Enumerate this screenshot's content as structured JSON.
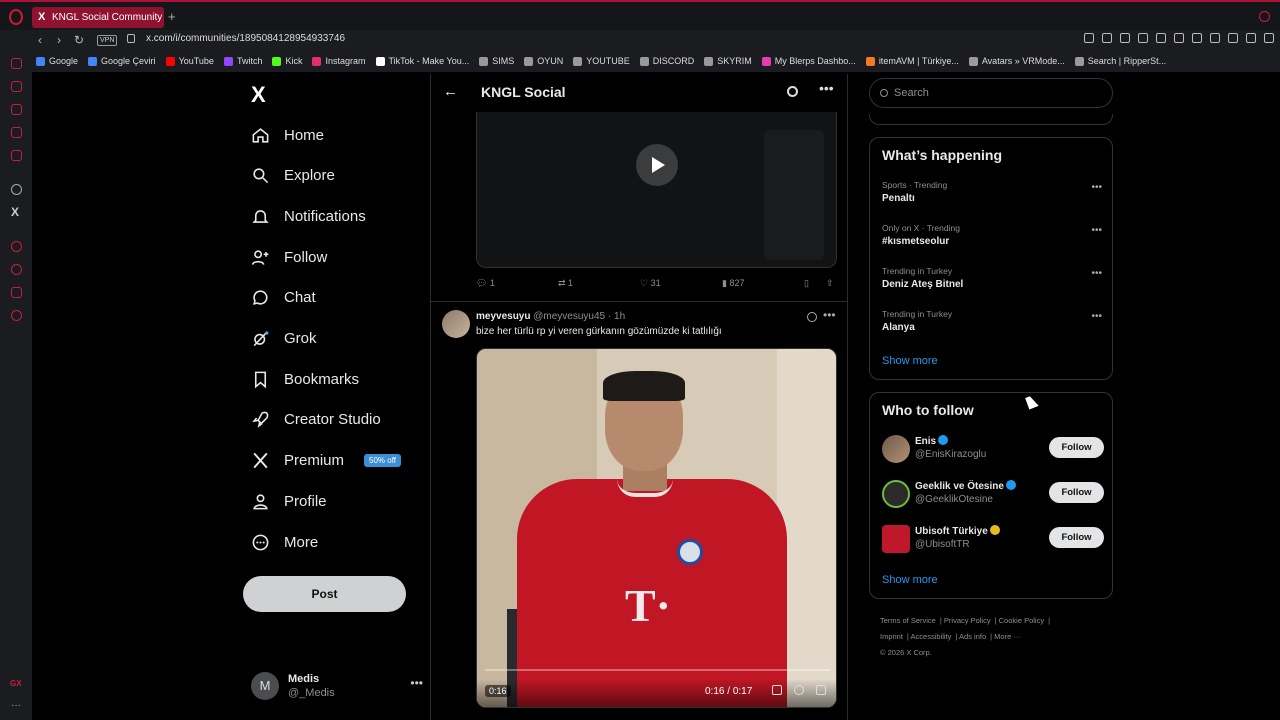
{
  "browser": {
    "tab_title": "KNGL Social Community /",
    "url": "x.com/i/communities/1895084128954933746",
    "vpn_label": "VPN",
    "bookmarks": [
      {
        "label": "Google",
        "color": "#4285f4"
      },
      {
        "label": "Google Çeviri",
        "color": "#4285f4"
      },
      {
        "label": "YouTube",
        "color": "#ff0000"
      },
      {
        "label": "Twitch",
        "color": "#9146ff"
      },
      {
        "label": "Kick",
        "color": "#53fc18"
      },
      {
        "label": "Instagram",
        "color": "#e1306c"
      },
      {
        "label": "TikTok - Make You...",
        "color": "#ffffff"
      },
      {
        "label": "SIMS",
        "color": "#999999"
      },
      {
        "label": "OYUN",
        "color": "#999999"
      },
      {
        "label": "YOUTUBE",
        "color": "#999999"
      },
      {
        "label": "DISCORD",
        "color": "#999999"
      },
      {
        "label": "SKYRIM",
        "color": "#999999"
      },
      {
        "label": "My Blerps Dashbo...",
        "color": "#e63cb1"
      },
      {
        "label": "itemAVM | Türkiye...",
        "color": "#f47a20"
      },
      {
        "label": "Avatars » VRMode...",
        "color": "#9a9a9a"
      },
      {
        "label": "Search | RipperSt...",
        "color": "#9a9a9a"
      }
    ]
  },
  "nav": {
    "brand": "X",
    "items": [
      {
        "label": "Home"
      },
      {
        "label": "Explore"
      },
      {
        "label": "Notifications"
      },
      {
        "label": "Follow"
      },
      {
        "label": "Chat"
      },
      {
        "label": "Grok"
      },
      {
        "label": "Bookmarks"
      },
      {
        "label": "Creator Studio"
      },
      {
        "label": "Premium",
        "badge": "50% off"
      },
      {
        "label": "Profile"
      },
      {
        "label": "More"
      }
    ],
    "post_label": "Post",
    "account": {
      "initial": "M",
      "name": "Medis",
      "handle": "@_Medis"
    }
  },
  "main": {
    "title": "KNGL Social",
    "post1_actions": {
      "replies": "1",
      "reposts": "1",
      "likes": "31",
      "views": "827"
    },
    "post2": {
      "name": "meyvesuyu",
      "handle": "@meyvesuyu45",
      "time": "· 1h",
      "text": "bize her türlü rp yi veren gürkanın gözümüzde ki tatlılığı",
      "elapsed": "0:16",
      "duration": "0:17"
    }
  },
  "right": {
    "search_placeholder": "Search",
    "whats_happening": "What’s happening",
    "trends": [
      {
        "context": "Sports · Trending",
        "title": "Penaltı"
      },
      {
        "context": "Only on X · Trending",
        "title": "#kısmetseolur"
      },
      {
        "context": "Trending in Turkey",
        "title": "Deniz Ateş Bitnel"
      },
      {
        "context": "Trending in Turkey",
        "title": "Alanya"
      }
    ],
    "show_more": "Show more",
    "who_to_follow": "Who to follow",
    "follow_users": [
      {
        "name": "Enis",
        "handle": "@EnisKirazoglu",
        "follow": "Follow"
      },
      {
        "name": "Geeklik ve Ötesine",
        "handle": "@GeeklikOtesine",
        "follow": "Follow"
      },
      {
        "name": "Ubisoft Türkiye",
        "handle": "@UbisoftTR",
        "follow": "Follow"
      }
    ],
    "footer": [
      "Terms of Service",
      "Privacy Policy",
      "Cookie Policy",
      "Imprint",
      "Accessibility",
      "Ads info",
      "More ···",
      "© 2026 X Corp."
    ]
  }
}
